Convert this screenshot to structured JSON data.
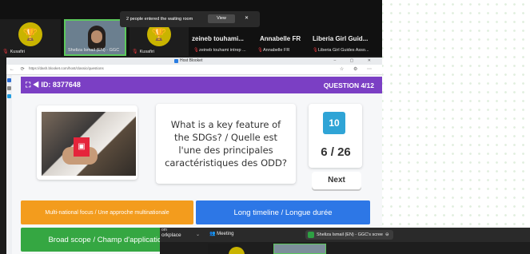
{
  "strip": {
    "tiles": [
      {
        "name": "Kusafiri"
      },
      {
        "name": "Sheliza Ismail (EN) - GGC"
      },
      {
        "name": "Kusafiri"
      }
    ],
    "participants": [
      {
        "big": "zeineb touhami...",
        "small": "zeineb touhami intrep ..."
      },
      {
        "big": "Annabelle FR",
        "small": "Annabelle FR"
      },
      {
        "big": "Liberia Girl Guid...",
        "small": "Liberia Girl Guides Asso..."
      }
    ]
  },
  "browser": {
    "tab_title": "Host Blooket",
    "url": "https://dash.blooket.com/host/classic/questions"
  },
  "toast": {
    "message": "2 people entered the waiting room",
    "view": "View",
    "close": "✕"
  },
  "game": {
    "id_label": "ID: 8377648",
    "question_label": "QUESTION 4/12",
    "question_text": "What is a key feature of the SDGs? / Quelle est l'une des principales caractéristiques des ODD?",
    "timer": "10",
    "answered": "6 / 26",
    "next": "Next",
    "answers": [
      {
        "text": "Multi-national focus / Une approche multinationale",
        "color": "#f39c1d"
      },
      {
        "text": "Long timeline / Longue durée",
        "color": "#2d77e6"
      },
      {
        "text": "Broad scope / Champ d'application",
        "color": "#35a742"
      }
    ]
  },
  "window2": {
    "line1": "om",
    "line2": "orkplace",
    "meeting": "Meeting",
    "share": "Sheliza Ismail (EN) - GGC's scree"
  }
}
